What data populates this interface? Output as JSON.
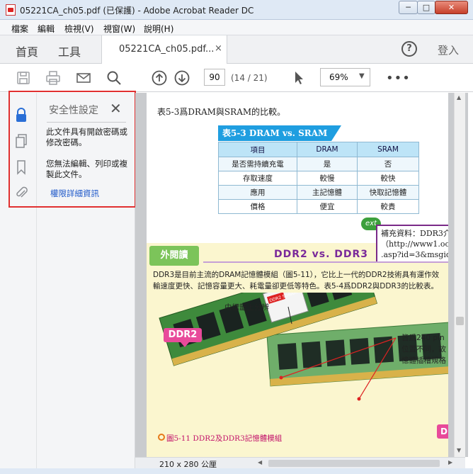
{
  "window": {
    "title": "05221CA_ch05.pdf (已保護) - Adobe Acrobat Reader DC",
    "minimize": "─",
    "maximize": "□",
    "close": "✕"
  },
  "menu": [
    "檔案",
    "編輯",
    "檢視(V)",
    "視窗(W)",
    "說明(H)"
  ],
  "tabs": {
    "home": "首頁",
    "tools": "工具",
    "document": "05221CA_ch05.pdf...",
    "close": "×",
    "help": "?",
    "login": "登入"
  },
  "toolbar": {
    "page_current": "90",
    "page_count": "(14 / 21)",
    "zoom": "69%",
    "zoom_arrow": "▼",
    "more": "•••"
  },
  "security_panel": {
    "title": "安全性設定",
    "close": "✕",
    "text1": "此文件具有開啟密碼或修改密碼。",
    "text2": "您無法編輯、列印或複製此文件。",
    "link": "權限詳細資訊"
  },
  "document": {
    "heading": "表5-3爲DRAM與SRAM的比較。",
    "table_title": "表5-3  DRAM vs. SRAM",
    "table_headers": [
      "項目",
      "DRAM",
      "SRAM"
    ],
    "table_rows": [
      [
        "是否需持續充電",
        "是",
        "否"
      ],
      [
        "存取速度",
        "較慢",
        "較快"
      ],
      [
        "應用",
        "主記憶體",
        "快取記憶體"
      ],
      [
        "價格",
        "便宜",
        "較貴"
      ]
    ],
    "ext_badge": "ext",
    "note_lines": [
      "補充資料：DDR3介",
      "（http://www1.oc.co",
      ".asp?id=3&msgid=4"
    ],
    "outside_title": "外閱讀",
    "section_title": "DDR2 vs. DDR3",
    "paragraph": [
      "DDR3是目前主流的DRAM記憶體模組（圖5-11），它比上一代的DDR2技術具有運作效",
      "輸速度更快、記憶容量更大、耗電量卻更低等特色。表5-4爲DDR2與DDR3的比較表。"
    ],
    "label_sticker": "由標籤上分辨",
    "label_pin": [
      "皆爲240 pin",
      "位置不同，故",
      "憶體插槽規格"
    ],
    "ddr2_tag": "DDR2",
    "d_tag": "D",
    "figure_caption": "圖5-11  DDR2及DDR3記憶體模組",
    "sticker_text": "DDR2 SDRAM"
  },
  "status": {
    "page_size": "210 x 280 公厘"
  },
  "colors": {
    "accent_blue": "#1f9ee0",
    "highlight_red": "#e03030",
    "lock_blue": "#2a6fd6",
    "section_purple": "#7a2a9a"
  }
}
